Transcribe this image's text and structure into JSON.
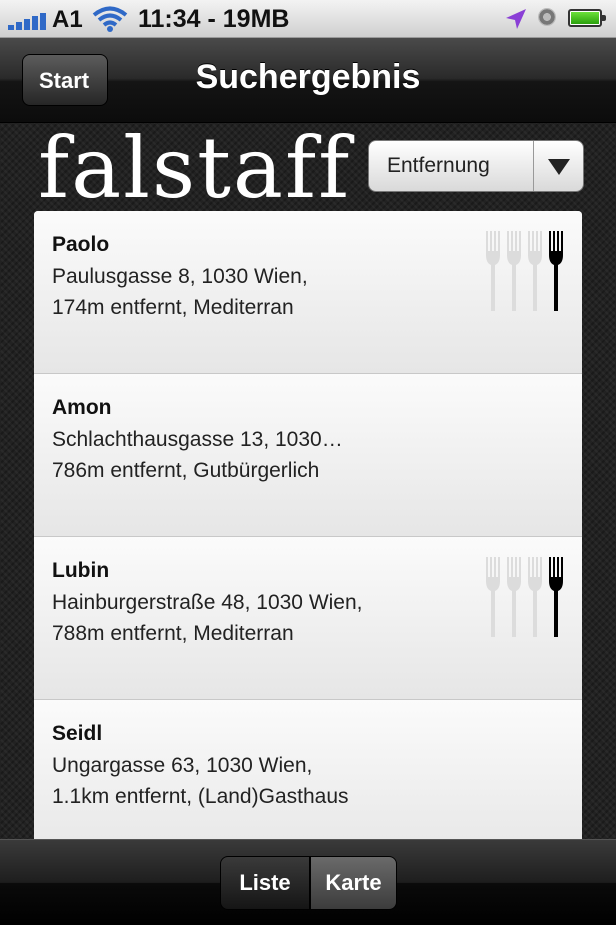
{
  "status_bar": {
    "carrier": "A1",
    "time": "11:34 - 19MB"
  },
  "navbar": {
    "back_label": "Start",
    "title": "Suchergebnis"
  },
  "brand": {
    "logo_text": "falstaff"
  },
  "sort_dropdown": {
    "selected": "Entfernung"
  },
  "results": [
    {
      "name": "Paolo",
      "address": "Paulusgasse 8, 1030 Wien,",
      "details": "174m entfernt, Mediterran",
      "forks": 1
    },
    {
      "name": "Amon",
      "address": "Schlachthausgasse 13, 1030…",
      "details": "786m entfernt, Gutbürgerlich",
      "forks": 0
    },
    {
      "name": "Lubin",
      "address": "Hainburgerstraße 48, 1030 Wien,",
      "details": "788m entfernt, Mediterran",
      "forks": 1
    },
    {
      "name": "Seidl",
      "address": "Ungargasse 63, 1030 Wien,",
      "details": "1.1km entfernt, (Land)Gasthaus",
      "forks": 0
    }
  ],
  "toolbar": {
    "list_label": "Liste",
    "map_label": "Karte"
  },
  "colors": {
    "accent_blue": "#2f69c7",
    "nav_dark": "#141414",
    "fork_active": "#000000",
    "fork_inactive": "#dcdcdc"
  }
}
